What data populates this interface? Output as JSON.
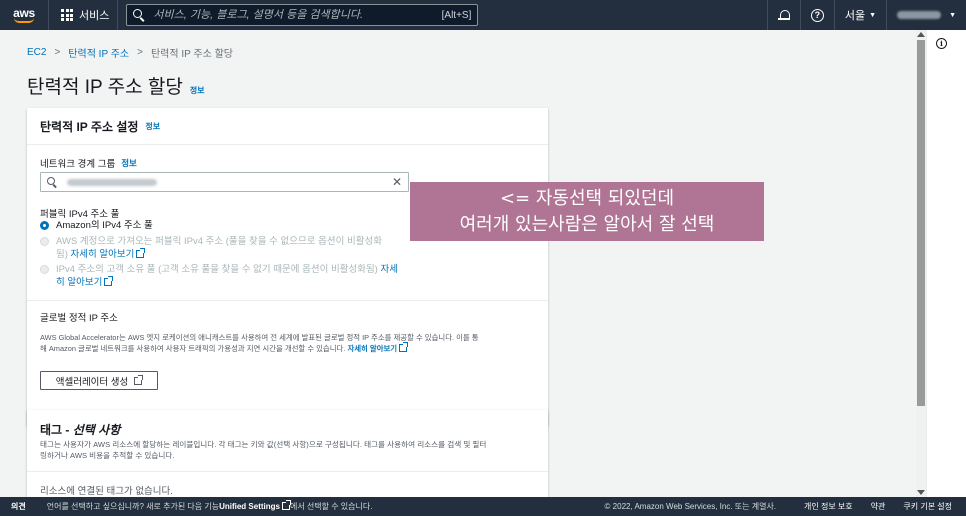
{
  "topnav": {
    "logo_text": "aws",
    "services_label": "서비스",
    "search_placeholder": "서비스, 기능, 블로그, 설명서 등을 검색합니다.",
    "search_shortcut": "[Alt+S]",
    "help_glyph": "?",
    "region": "서울",
    "caret": "▼"
  },
  "breadcrumb": {
    "items": [
      "EC2",
      "탄력적 IP 주소"
    ],
    "current": "탄력적 IP 주소 할당",
    "separator": ">"
  },
  "page": {
    "title": "탄력적 IP 주소 할당",
    "info_label": "정보"
  },
  "settings_panel": {
    "title": "탄력적 IP 주소 설정",
    "info_label": "정보",
    "network_border_group_label": "네트워크 경계 그룹",
    "network_border_group_info": "정보",
    "clear_glyph": "✕",
    "public_pool_label": "퍼블릭 IPv4 주소 풀",
    "options": [
      {
        "label": "Amazon의 IPv4 주소 풀",
        "selected": true,
        "disabled": false
      },
      {
        "label": "AWS 계정으로 가져오는 퍼블릭 IPv4 주소 (풀을 찾을 수 없으므로 옵션이 비활성화",
        "label2": "됨)",
        "link": "자세히 알아보기",
        "selected": false,
        "disabled": true
      },
      {
        "label": "IPv4 주소의 고객 소유 풀 (고객 소유 풀을 찾을 수 없기 때문에 옵션이 비활성화됨)",
        "link_part1": "자세",
        "link_part2": "히 알아보기",
        "selected": false,
        "disabled": true
      }
    ],
    "global_static_label": "글로벌 정적 IP 주소",
    "global_desc_line1": "AWS Global Accelerator는 AWS 엣지 로케이션의 애니캐스트를 사용하여 전 세계에 발표된 글로벌 정적 IP 주소를 제공할 수 있습니다. 이를 통",
    "global_desc_line2": "해 Amazon 글로벌 네트워크를 사용하여 사용자 트래픽의 가용성과 지연 시간을 개선할 수 있습니다.",
    "global_desc_link": "자세히 알아보기",
    "create_accelerator_label": "액셀러레이터 생성"
  },
  "tags_panel": {
    "title_prefix": "태그 -",
    "title_optional": "선택 사항",
    "desc_line1": "태그는 사용자가 AWS 리소스에 할당하는 레이블입니다. 각 태그는 키와 값(선택 사항)으로 구성됩니다. 태그를 사용하여 리소스를 검색 및 필터",
    "desc_line2": "링하거나 AWS 비용을 추적할 수 있습니다.",
    "empty_text": "리소스에 연결된 태그가 없습니다."
  },
  "annotation": {
    "line1": "<= 자동선택 되있던데",
    "line2": "여러개 있는사람은 알아서 잘 선택",
    "bg_color": "#b07594"
  },
  "rail": {
    "info_glyph": "i"
  },
  "footer": {
    "feedback": "의견",
    "message_prefix": "언어를 선택하고 싶으십니까? 새로 추가된 다음 기능",
    "message_bold": "Unified Settings",
    "message_suffix": "에서 선택할 수 있습니다.",
    "copyright": "© 2022, Amazon Web Services, Inc. 또는 계열사.",
    "links": [
      "개인 정보 보호",
      "약관",
      "쿠키 기본 설정"
    ]
  },
  "colors": {
    "nav_bg": "#232f3e",
    "link": "#0073bb",
    "aws_orange": "#ff9900",
    "page_bg": "#f2f3f3"
  }
}
